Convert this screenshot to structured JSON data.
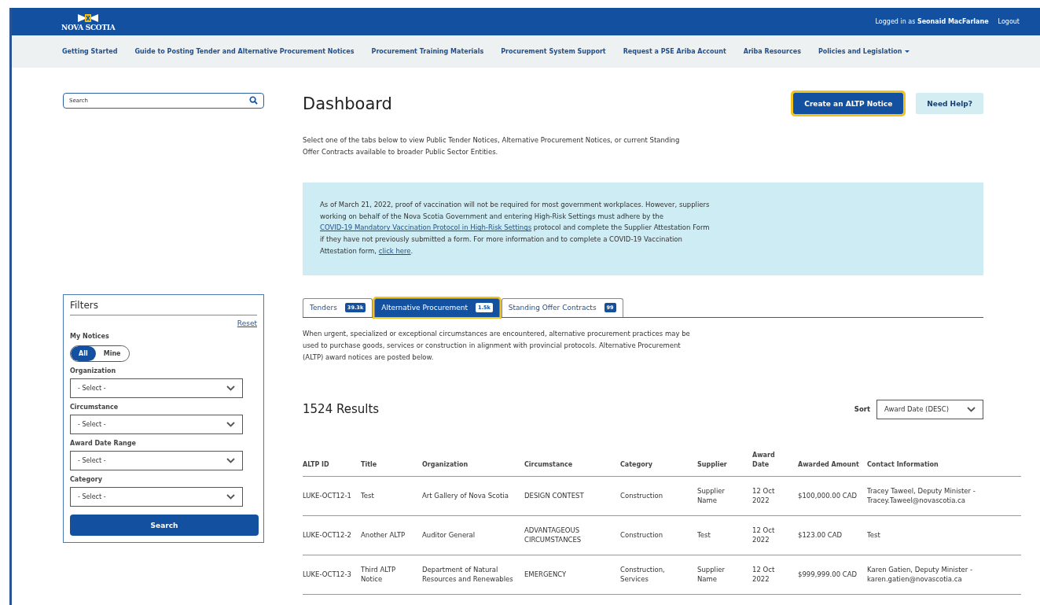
{
  "header": {
    "logo_text": "NOVA SCOTIA",
    "user_text": "Logged in as **Seonaid MacFarlane**",
    "logout": "Logout"
  },
  "nav": [
    {
      "label": "Getting Started",
      "dropdown": false
    },
    {
      "label": "Guide to Posting Tender and Alternative Procurement Notices",
      "dropdown": false
    },
    {
      "label": "Procurement Training Materials",
      "dropdown": false
    },
    {
      "label": "Procurement System Support",
      "dropdown": false
    },
    {
      "label": "Request a PSE Ariba Account",
      "dropdown": false
    },
    {
      "label": "Ariba Resources",
      "dropdown": false
    },
    {
      "label": "Policies and Legislation",
      "dropdown": true
    }
  ],
  "search": {
    "placeholder": "Search"
  },
  "filters": {
    "title": "Filters",
    "reset": "Reset",
    "my_notices_label": "My Notices",
    "toggle": [
      {
        "label": "All",
        "selected": true
      },
      {
        "label": "Mine",
        "selected": false
      }
    ],
    "selects": [
      {
        "label": "Organization",
        "value": "- Select -"
      },
      {
        "label": "Circumstance",
        "value": "- Select -"
      },
      {
        "label": "Award Date Range",
        "value": "- Select -"
      },
      {
        "label": "Category",
        "value": "- Select -"
      }
    ],
    "search_button": "Search"
  },
  "page_title": "Dashboard",
  "buttons": [
    {
      "label": "Create an ALTP Notice",
      "kind": "primary",
      "focused": true
    },
    {
      "label": "Need Help?",
      "kind": "secondary",
      "focused": false
    }
  ],
  "intro": "Select one of the tabs below to view Public Tender Notices, Alternative Procurement Notices, or current Standing Offer Contracts available to broader Public Sector Entities.",
  "alert": [
    {
      "kind": "text",
      "text": "As of March 21, 2022, proof of vaccination will not be required for most government workplaces. However, suppliers working on behalf of the Nova Scotia Government and entering High-Risk Settings must adhere by the "
    },
    {
      "kind": "link",
      "text": "COVID-19 Mandatory Vaccination Protocol in High-Risk Settings"
    },
    {
      "kind": "text",
      "text": " protocol and complete the Supplier Attestation Form if they have not previously submitted a form. For more information and to complete a COVID-19 Vaccination Attestation form, "
    },
    {
      "kind": "link",
      "text": "click here"
    },
    {
      "kind": "text",
      "text": "."
    }
  ],
  "tabs": [
    {
      "label": "Tenders",
      "count": "39.3k",
      "selected": false
    },
    {
      "label": "Alternative Procurement",
      "count": "1.5k",
      "selected": true
    },
    {
      "label": "Standing Offer Contracts",
      "count": "99",
      "selected": false
    }
  ],
  "tab_description": "When urgent, specialized or exceptional circumstances are encountered, alternative procurement practices may be used to purchase goods, services or construction in alignment with provincial protocols. Alternative Procurement (ALTP) award notices are posted below.",
  "results_count": "1524 Results",
  "sort": {
    "label": "Sort",
    "value": "Award Date (DESC)"
  },
  "table": {
    "columns": [
      "ALTP ID",
      "Title",
      "Organization",
      "Circumstance",
      "Category",
      "Supplier",
      "Award Date",
      "Awarded Amount",
      "Contact Information"
    ],
    "rows": [
      [
        "LUKE-OCT12-1",
        "Test",
        "Art Gallery of Nova Scotia",
        "DESIGN CONTEST",
        "Construction",
        "Supplier Name",
        "12 Oct 2022",
        "$100,000.00 CAD",
        "Tracey Taweel, Deputy Minister - Tracey.Taweel@novascotia.ca"
      ],
      [
        "LUKE-OCT12-2",
        "Another ALTP",
        "Auditor General",
        "ADVANTAGEOUS CIRCUMSTANCES",
        "Construction",
        "Test",
        "12 Oct 2022",
        "$123.00 CAD",
        "Test"
      ],
      [
        "LUKE-OCT12-3",
        "Third ALTP Notice",
        "Department of Natural Resources and Renewables",
        "EMERGENCY",
        "Construction, Services",
        "Supplier Name",
        "12 Oct 2022",
        "$999,999.00 CAD",
        "Karen Gatien, Deputy Minister - karen.gatien@novascotia.ca"
      ]
    ]
  }
}
